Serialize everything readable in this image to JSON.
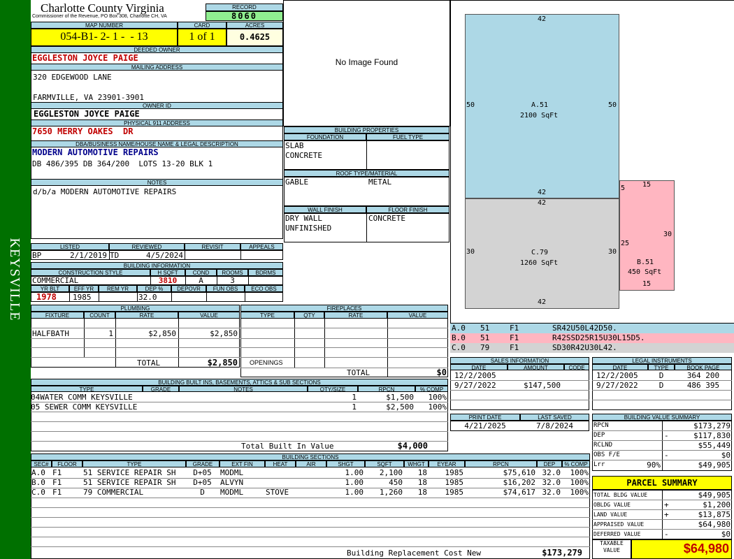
{
  "sidebar": {
    "district": "KEYSVILLE"
  },
  "header": {
    "county": "Charlotte County Virginia",
    "commissioner": "Commissioner of the Revenue, PO Box 308, Charlotte CH, VA",
    "record_label": "RECORD",
    "record": "8060",
    "map_label": "MAP NUMBER",
    "map": "054-B1- 2- 1 -  - 13",
    "card_label": "CARD",
    "card": "1 of 1",
    "acres_label": "ACRES",
    "acres": "0.4625"
  },
  "owner": {
    "deeded_label": "DEEDED OWNER",
    "deeded": "EGGLESTON JOYCE PAIGE",
    "mailing_label": "MAILING ADDRESS",
    "mail1": "320 EDGEWOOD LANE",
    "mail2": "FARMVILLE, VA 23901-3901",
    "ownerid_label": "OWNER ID",
    "ownerid": "EGGLESTON JOYCE PAIGE",
    "phys_label": "PHYSICAL 911 ADDRESS",
    "phys": "7650 MERRY OAKES  DR",
    "dba_label": "DBA/BUSINESS NAME/HOUSE NAME & LEGAL DESCRIPTION",
    "dba": "MODERN AUTOMOTIVE REPAIRS",
    "legal": "DB 486/395 DB 364/200  LOTS 13-20 BLK 1",
    "notes_label": "NOTES",
    "notes": "d/b/a MODERN AUTOMOTIVE REPAIRS"
  },
  "listed": {
    "listed_label": "LISTED",
    "reviewed_label": "REVIEWED",
    "revisit_label": "REVISIT",
    "appeals_label": "APPEALS",
    "lby": "BP",
    "ldate": "2/1/2019",
    "rby": "TD",
    "rdate": "4/5/2024"
  },
  "building_info": {
    "label": "BUILDING INFORMATION",
    "cs_label": "CONSTRUCTION STYLE",
    "hsqft_label": "H SQFT",
    "cond_label": "COND",
    "rooms_label": "ROOMS",
    "bdrms_label": "BDRMS",
    "cs": "COMMERCIAL",
    "hsqft": "3810",
    "cond": "A",
    "rooms": "3",
    "yb_label": "YR BLT",
    "eff_label": "EFF YR",
    "rem_label": "REM YR",
    "dep_label": "DEP %",
    "depovr_label": "DEPOVR",
    "fun_label": "FUN OBS",
    "eco_label": "ECO OBS",
    "yb": "1978",
    "eff": "1985",
    "dep": "32.0"
  },
  "image": {
    "placeholder": "No Image Found"
  },
  "bprops": {
    "label": "BUILDING PROPERTIES",
    "found_label": "FOUNDATION",
    "fuel_label": "FUEL TYPE",
    "found1": "SLAB",
    "found2": "CONCRETE",
    "roof_label": "ROOF TYPE/MATERIAL",
    "roof1": "GABLE",
    "roof2": "METAL",
    "wall_label": "WALL FINISH",
    "floor_label": "FLOOR FINISH",
    "wall1": "DRY WALL",
    "wall2": "UNFINISHED",
    "floor": "CONCRETE"
  },
  "plumbing": {
    "label": "PLUMBING",
    "h_fixture": "FIXTURE",
    "h_count": "COUNT",
    "h_rate": "RATE",
    "h_value": "VALUE",
    "fixture": "HALFBATH",
    "count": "1",
    "rate": "$2,850",
    "value": "$2,850",
    "total_label": "TOTAL",
    "total": "$2,850"
  },
  "fireplaces": {
    "label": "FIREPLACES",
    "h_type": "TYPE",
    "h_qty": "QTY",
    "h_rate": "RATE",
    "h_value": "VALUE",
    "openings": "OPENINGS",
    "total_label": "TOTAL",
    "total": "$0"
  },
  "builtins": {
    "label": "BUILDING BUILT INS, BASEMENTS, ATTICS & SUB SECTIONS",
    "h_type": "TYPE",
    "h_grade": "GRADE",
    "h_notes": "NOTES",
    "h_qty": "QTY/SIZE",
    "h_rpcn": "RPCN",
    "h_comp": "% COMP",
    "r1_type": "04WATER COMM KEYSVILLE",
    "r1_qty": "1",
    "r1_rpcn": "$1,500",
    "r1_comp": "100%",
    "r2_type": "05 SEWER COMM KEYSVILLE",
    "r2_qty": "1",
    "r2_rpcn": "$2,500",
    "r2_comp": "100%",
    "total_label": "Total Built In Value",
    "total": "$4,000"
  },
  "sections": {
    "label": "BUILDING SECTIONS",
    "headers": [
      "SEC#",
      "FLOOR",
      "TYPE",
      "GRADE",
      "EXT FIN",
      "HEAT",
      "AIR",
      "SHGT",
      "SQFT",
      "WHGT",
      "EYEAR",
      "RPCN",
      "DEP",
      "% COMP"
    ],
    "rows": [
      [
        "A.0",
        "F1",
        "51 SERVICE REPAIR SH",
        "D+05",
        "MODML",
        "",
        "",
        "1.00",
        "2,100",
        "18",
        "1985",
        "$75,610",
        "32.0",
        "100%"
      ],
      [
        "B.0",
        "F1",
        "51 SERVICE REPAIR SH",
        "D+05",
        "ALVYN",
        "",
        "",
        "1.00",
        "450",
        "18",
        "1985",
        "$16,202",
        "32.0",
        "100%"
      ],
      [
        "C.0",
        "F1",
        "79 COMMERCIAL",
        "D",
        "MODML",
        "STOVE",
        "",
        "1.00",
        "1,260",
        "18",
        "1985",
        "$74,617",
        "32.0",
        "100%"
      ]
    ],
    "brcn_label": "Building Replacement Cost New",
    "brcn": "$173,279"
  },
  "sketch": {
    "a_name": "A.51",
    "a_area": "2100 SqFt",
    "b_name": "B.51",
    "b_area": "450 SqFt",
    "c_name": "C.79",
    "c_area": "1260 SqFt",
    "dims": {
      "a_top": "42",
      "a_left": "50",
      "a_right": "50",
      "a_bot": "42",
      "c_top": "42",
      "c_left": "30",
      "c_right": "30",
      "c_bot": "42",
      "b_top": "15",
      "b_left5": "5",
      "b_left25": "25",
      "b_right": "30",
      "b_bot": "15"
    },
    "trace": [
      {
        "sec": "A.0",
        "code": "51",
        "floor": "F1",
        "path": "SR42U50L42D50.",
        "color": "#add8e6"
      },
      {
        "sec": "B.0",
        "code": "51",
        "floor": "F1",
        "path": "R42SSD25R15U30L15D5.",
        "color": "#ffb6c1"
      },
      {
        "sec": "C.0",
        "code": "79",
        "floor": "F1",
        "path": "SD30R42U30L42.",
        "color": "#d3d3d3"
      }
    ]
  },
  "sales": {
    "label": "SALES INFORMATION",
    "h_date": "DATE",
    "h_amount": "AMOUNT",
    "h_code": "CODE",
    "r1_date": "12/2/2005",
    "r1_amount": "",
    "r2_date": "9/27/2022",
    "r2_amount": "$147,500"
  },
  "legal": {
    "label": "LEGAL INSTRUMENTS",
    "h_date": "DATE",
    "h_type": "TYPE",
    "h_book": "BOOK PAGE",
    "r1_date": "12/2/2005",
    "r1_type": "D",
    "r1_book": "364 200",
    "r2_date": "9/27/2022",
    "r2_type": "D",
    "r2_book": "486 395"
  },
  "dates": {
    "print_label": "PRINT DATE",
    "saved_label": "LAST SAVED",
    "print": "4/21/2025",
    "saved": "7/8/2024"
  },
  "bvs": {
    "label": "BUILDING VALUE SUMMARY",
    "rpcn_l": "RPCN",
    "rpcn": "$173,279",
    "dep_l": "DEP",
    "dep_s": "-",
    "dep": "$117,830",
    "rclnd_l": "RCLND",
    "rclnd": "$55,449",
    "obs_l": "OBS F/E",
    "obs_s": "-",
    "obs": "$0",
    "lrr_l": "Lrr",
    "lrr_p": "90%",
    "lrr": "$49,905"
  },
  "parcel": {
    "title": "PARCEL SUMMARY",
    "tb_l": "TOTAL BLDG VALUE",
    "tb": "$49,905",
    "ob_l": "OBLDG VALUE",
    "ob_s": "+",
    "ob": "$1,200",
    "lv_l": "LAND VALUE",
    "lv_s": "+",
    "lv": "$13,875",
    "av_l": "APPRAISED VALUE",
    "av": "$64,980",
    "dv_l": "DEFERRED VALUE",
    "dv_s": "-",
    "dv": "$0",
    "tx_l1": "TAXABLE",
    "tx_l2": "VALUE",
    "tx": "$64,980"
  },
  "colors": {
    "sidebar": "#007000",
    "header": "#add8e6",
    "record": "#90ee90",
    "yellow": "#ffff00",
    "red": "#c00000",
    "blue": "#00008b"
  }
}
